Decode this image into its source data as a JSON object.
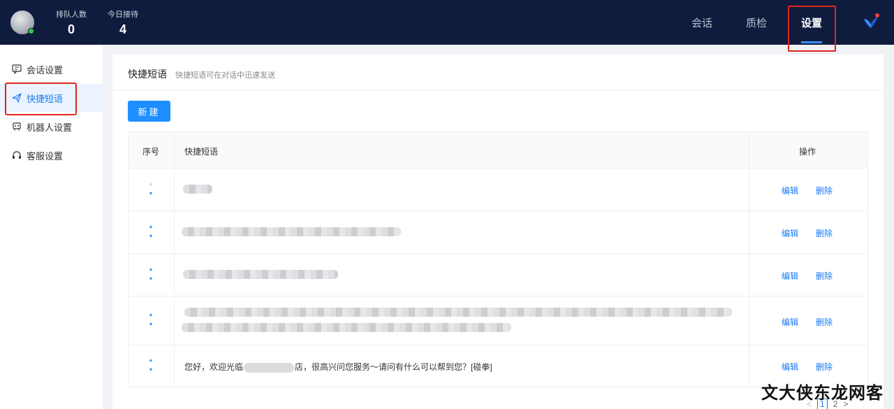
{
  "header": {
    "stats": [
      {
        "label": "排队人数",
        "value": "0"
      },
      {
        "label": "今日接待",
        "value": "4"
      }
    ],
    "nav": [
      {
        "label": "会话"
      },
      {
        "label": "质检"
      },
      {
        "label": "设置"
      }
    ],
    "active_nav": "设置",
    "accent_color": "#3b8dff"
  },
  "sidebar": {
    "items": [
      {
        "label": "会话设置",
        "icon": "chat-settings-icon"
      },
      {
        "label": "快捷短语",
        "icon": "paper-plane-icon"
      },
      {
        "label": "机器人设置",
        "icon": "robot-icon"
      },
      {
        "label": "客服设置",
        "icon": "headset-icon"
      }
    ],
    "active": "快捷短语"
  },
  "main": {
    "title": "快捷短语",
    "subtitle": "快捷短语可在对话中迅速发送",
    "new_button": "新建",
    "table": {
      "columns": [
        "序号",
        "快捷短语",
        "操作"
      ],
      "rows": [
        {
          "text": "",
          "blurred": true
        },
        {
          "text": "",
          "blurred": true
        },
        {
          "text": "",
          "blurred": true
        },
        {
          "text": "",
          "blurred": true
        },
        {
          "text_before": "您好，欢迎光临",
          "text_after": "店，很高兴问您服务～请问有什么可以帮到您？[碰拳]",
          "blurred": false
        }
      ],
      "actions": {
        "edit": "编辑",
        "delete": "删除"
      }
    },
    "pagination": {
      "prev": "<",
      "pages": [
        "1",
        "2"
      ],
      "current": "1",
      "next": ">"
    }
  },
  "watermark": "文大侠东龙网客"
}
